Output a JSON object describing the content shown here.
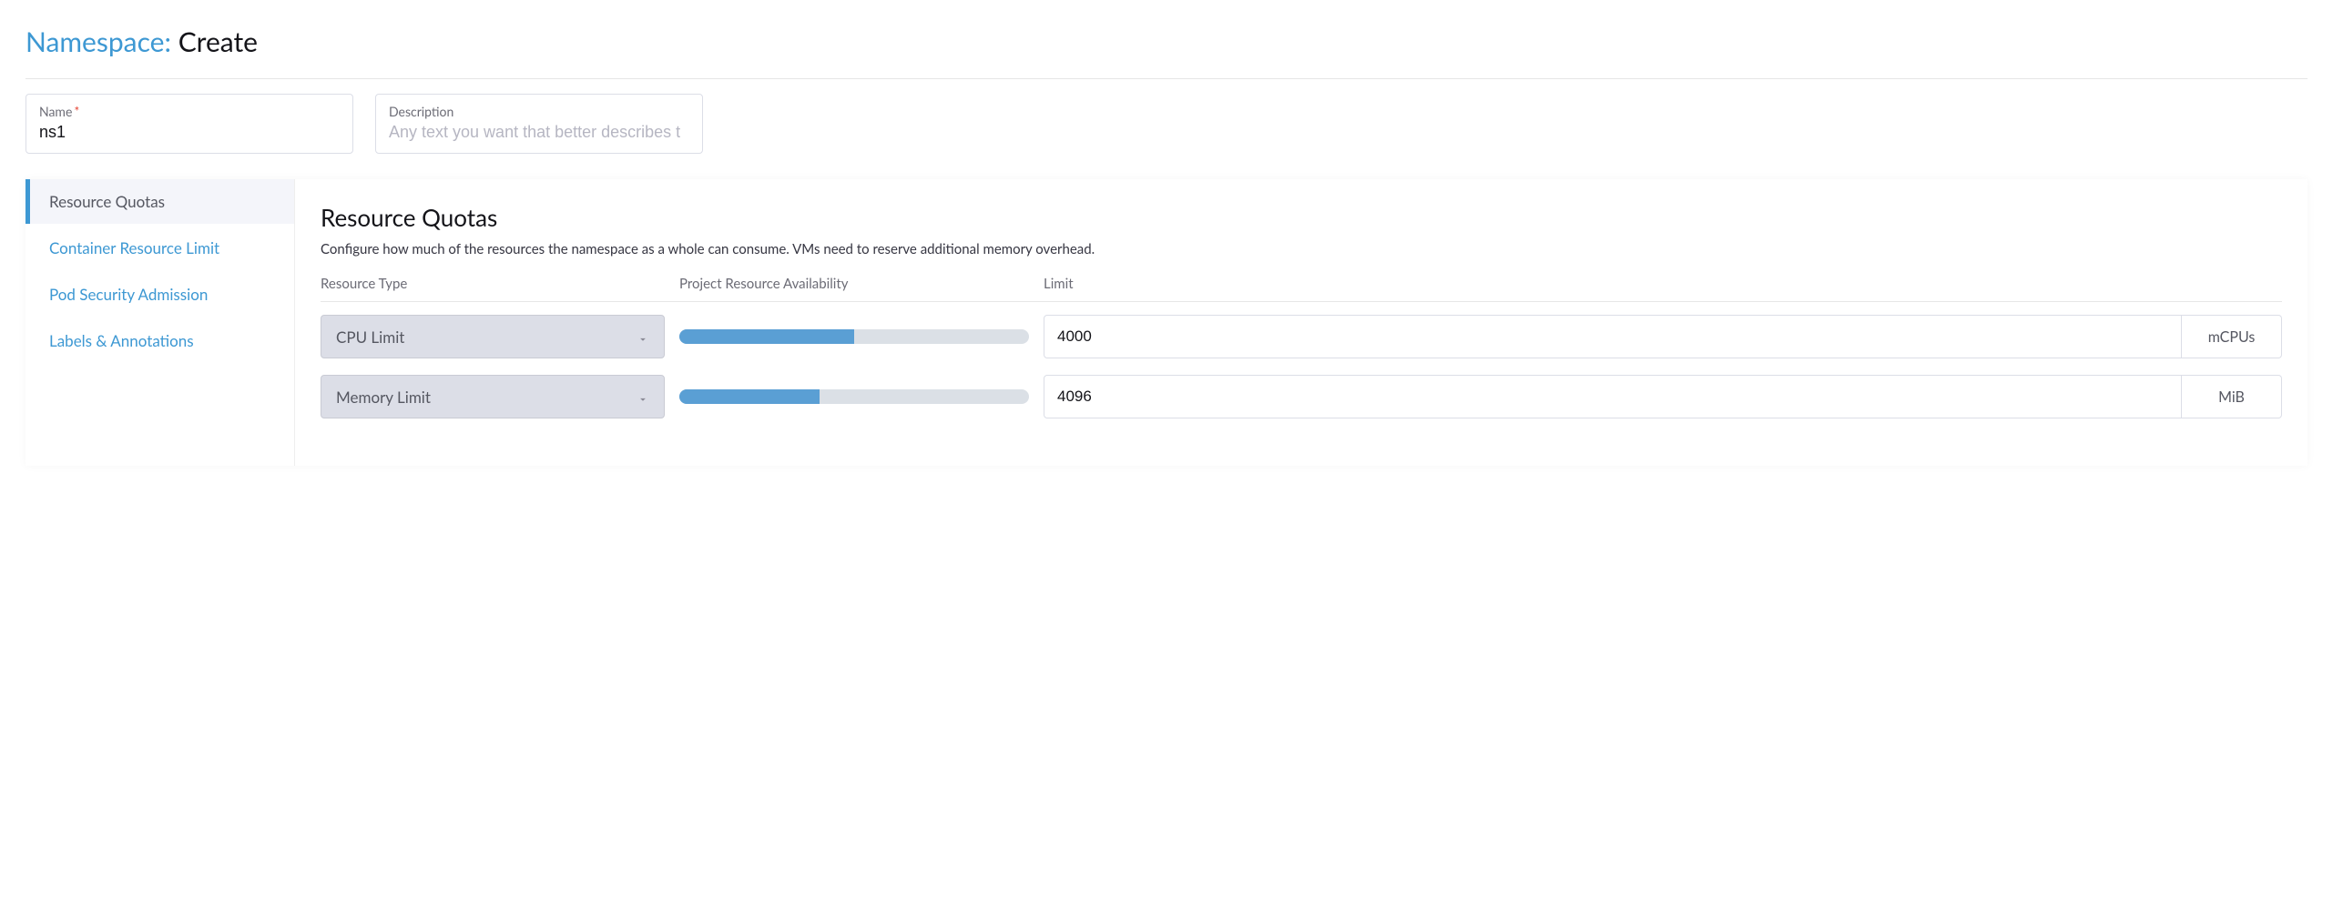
{
  "title": {
    "prefix": "Namespace:",
    "action": "Create"
  },
  "fields": {
    "name": {
      "label": "Name",
      "value": "ns1"
    },
    "description": {
      "label": "Description",
      "placeholder": "Any text you want that better describes t"
    }
  },
  "tabs": [
    {
      "label": "Resource Quotas",
      "active": true
    },
    {
      "label": "Container Resource Limit",
      "active": false
    },
    {
      "label": "Pod Security Admission",
      "active": false
    },
    {
      "label": "Labels & Annotations",
      "active": false
    }
  ],
  "section": {
    "title": "Resource Quotas",
    "description": "Configure how much of the resources the namespace as a whole can consume. VMs need to reserve additional memory overhead.",
    "columns": {
      "type": "Resource Type",
      "avail": "Project Resource Availability",
      "limit": "Limit"
    },
    "rows": [
      {
        "type": "CPU Limit",
        "progress_pct": 50,
        "value": "4000",
        "unit": "mCPUs"
      },
      {
        "type": "Memory Limit",
        "progress_pct": 40,
        "value": "4096",
        "unit": "MiB"
      }
    ]
  }
}
